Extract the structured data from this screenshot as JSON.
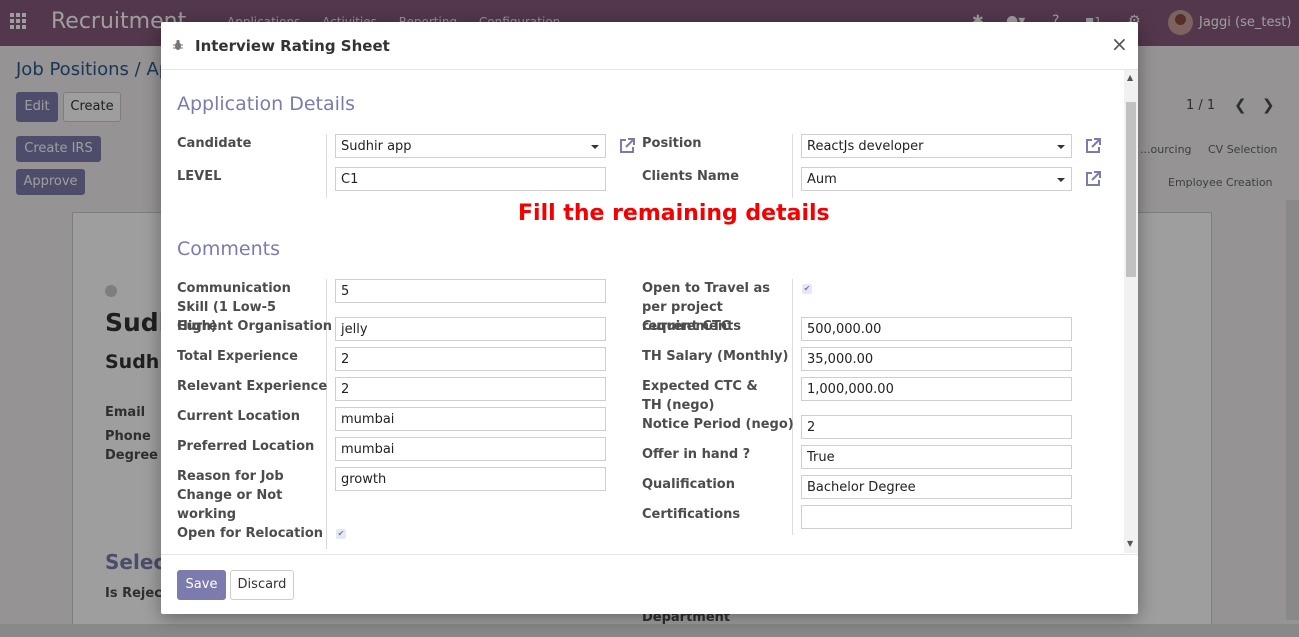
{
  "navbar": {
    "app_title": "Recruitment",
    "menu": [
      "Applications",
      "Activities",
      "Reporting",
      "Configuration"
    ],
    "chat_count": "1",
    "user_name": "Jaggi (se_test)"
  },
  "control_panel": {
    "breadcrumb": "Job Positions / Ap",
    "edit_label": "Edit",
    "create_label": "Create",
    "create_irs_label": "Create IRS",
    "approve_label": "Approve",
    "pager": "1 / 1",
    "stages_row1": [
      "...ourcing",
      "CV Selection"
    ],
    "stages_row2": [
      "Employee Creation"
    ]
  },
  "background_form": {
    "name_1": "Sudh",
    "name_2": "Sudhi",
    "email_label": "Email",
    "phone_label": "Phone",
    "degree_label": "Degree",
    "section_partial": "Select",
    "is_rejected_label": "Is Rejecte",
    "department_label": "Department"
  },
  "modal": {
    "title": "Interview Rating Sheet",
    "close_symbol": "×",
    "notice": "Fill the remaining details",
    "save_label": "Save",
    "discard_label": "Discard",
    "application_details": {
      "section_title": "Application Details",
      "candidate_label": "Candidate",
      "candidate_value": "Sudhir app",
      "level_label": "LEVEL",
      "level_value": "C1",
      "position_label": "Position",
      "position_value": "ReactJs developer",
      "clients_label": "Clients Name",
      "clients_value": "Aum"
    },
    "comments": {
      "section_title": "Comments",
      "left": {
        "communication_label": "Communication Skill (1 Low-5 High)",
        "communication_value": "5",
        "current_org_label": "Current Organisation",
        "current_org_value": "jelly",
        "total_exp_label": "Total Experience",
        "total_exp_value": "2",
        "relevant_exp_label": "Relevant Experience",
        "relevant_exp_value": "2",
        "current_location_label": "Current Location",
        "current_location_value": "mumbai",
        "preferred_location_label": "Preferred Location",
        "preferred_location_value": "mumbai",
        "reason_label": "Reason for Job Change or Not working",
        "reason_value": "growth",
        "relocation_label": "Open for Relocation",
        "relocation_checked": true
      },
      "right": {
        "travel_label": "Open to Travel as per project requirements",
        "travel_checked": true,
        "current_ctc_label": "Current CTC",
        "current_ctc_value": "500,000.00",
        "th_salary_label": "TH Salary (Monthly)",
        "th_salary_value": "35,000.00",
        "expected_ctc_label": "Expected CTC & TH (nego)",
        "expected_ctc_value": "1,000,000.00",
        "notice_period_label": "Notice Period (nego)",
        "notice_period_value": "2",
        "offer_label": "Offer in hand ?",
        "offer_value": "True",
        "qualification_label": "Qualification",
        "qualification_value": "Bachelor Degree",
        "certifications_label": "Certifications",
        "certifications_value": ""
      }
    }
  },
  "colors": {
    "navbar": "#875a7b",
    "primary_button": "#7c7bad",
    "section_title": "#7b7bad",
    "notice": "#f40000"
  }
}
